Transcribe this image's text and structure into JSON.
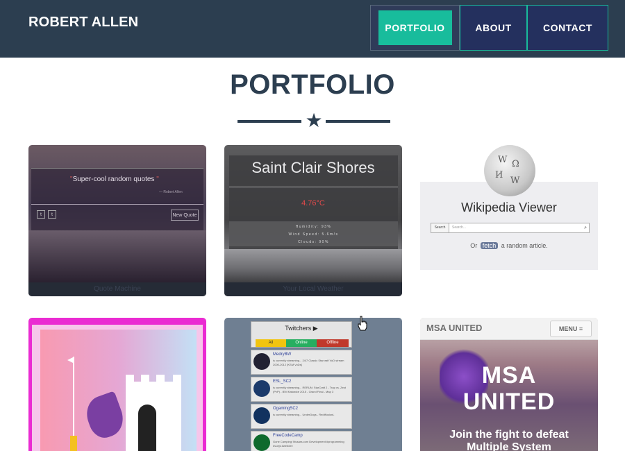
{
  "nav": {
    "brand": "ROBERT ALLEN",
    "items": [
      {
        "label": "PORTFOLIO",
        "active": true
      },
      {
        "label": "ABOUT",
        "active": false
      },
      {
        "label": "CONTACT",
        "active": false
      }
    ]
  },
  "main": {
    "title": "PORTFOLIO",
    "divider_icon": "star-icon"
  },
  "projects": {
    "quote_machine": {
      "quote_open": "\"",
      "quote_text": "Super-cool random quotes ",
      "quote_close": "\"",
      "author": "— Robert Allen",
      "new_quote_label": "New Quote",
      "caption": "Quote Machine"
    },
    "weather": {
      "city": "Saint Clair Shores",
      "temp": "4.76°C",
      "humidity": "Humidity: 93%",
      "wind": "Wind Speed: 5.6m/s",
      "clouds": "Clouds: 90%",
      "caption": "Your Local Weather"
    },
    "wikipedia": {
      "title": "Wikipedia Viewer",
      "search_button": "Search",
      "search_placeholder": "Search...",
      "or_text": "Or",
      "fetch_label": "fetch",
      "random_text": "a random article."
    },
    "twitch": {
      "title": "Twitchers ▶",
      "tabs": [
        {
          "label": "All",
          "color": "#f1c40f"
        },
        {
          "label": "Online",
          "color": "#27ae60"
        },
        {
          "label": "Offline",
          "color": "#c0392b"
        }
      ],
      "channels": [
        {
          "name": "MedryBW",
          "status": "is currently streaming... 24/7 Classic Starcraft VoD stream 2000-2012 [KSM VoDs]"
        },
        {
          "name": "ESL_SC2",
          "status": "is currently streaming... RERUN: StarCraft 2 - Trap vs. Zest (PvP) - IEM Katowice 2015 - Grand Final - Map 3"
        },
        {
          "name": "OgamingSC2",
          "status": "is currently streaming... UnderDogs - RediffusionL"
        },
        {
          "name": "FreeCodeCamp",
          "status": "Gone Camping! Musara.com Development #programming #vuejs #webdev"
        }
      ]
    },
    "msa": {
      "logo": "MSA UNITED",
      "menu_label": "MENU ≡",
      "big_text_1": "MSA",
      "big_text_2": "UNITED",
      "join_text_1": "Join the fight to defeat",
      "join_text_2": "Multiple System"
    }
  },
  "colors": {
    "navbar": "#2c3e50",
    "accent": "#18bc9c",
    "nav_button": "#24305e",
    "heading": "#2c3e50"
  }
}
